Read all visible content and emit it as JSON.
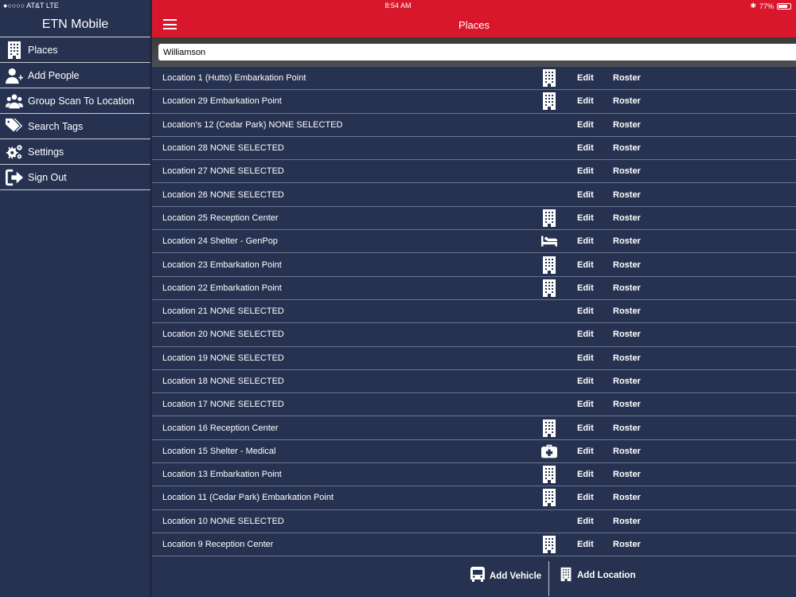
{
  "status": {
    "carrier": "●○○○○ AT&T  LTE",
    "time": "8:54 AM",
    "battery": "77%",
    "battery_level": 0.77
  },
  "sidebar": {
    "title": "ETN Mobile",
    "items": [
      {
        "label": "Places",
        "icon": "building-icon"
      },
      {
        "label": "Add People",
        "icon": "add-user-icon"
      },
      {
        "label": "Group Scan To Location",
        "icon": "group-icon"
      },
      {
        "label": "Search Tags",
        "icon": "tags-icon"
      },
      {
        "label": "Settings",
        "icon": "gears-icon"
      },
      {
        "label": "Sign Out",
        "icon": "sign-out-icon"
      }
    ]
  },
  "header": {
    "title": "Places"
  },
  "search": {
    "value": "Williamson"
  },
  "actions": {
    "edit": "Edit",
    "roster": "Roster"
  },
  "places": [
    {
      "name": "Location 1  (Hutto) Embarkation Point",
      "icon": "building"
    },
    {
      "name": "Location 29 Embarkation Point",
      "icon": "building"
    },
    {
      "name": "Location's 12  (Cedar Park) NONE SELECTED",
      "icon": ""
    },
    {
      "name": "Location 28 NONE SELECTED",
      "icon": ""
    },
    {
      "name": "Location 27 NONE SELECTED",
      "icon": ""
    },
    {
      "name": "Location 26 NONE SELECTED",
      "icon": ""
    },
    {
      "name": "Location 25 Reception Center",
      "icon": "building"
    },
    {
      "name": "Location 24 Shelter - GenPop",
      "icon": "bed"
    },
    {
      "name": "Location 23 Embarkation Point",
      "icon": "building"
    },
    {
      "name": "Location 22 Embarkation Point",
      "icon": "building"
    },
    {
      "name": "Location 21 NONE SELECTED",
      "icon": ""
    },
    {
      "name": "Location 20 NONE SELECTED",
      "icon": ""
    },
    {
      "name": "Location 19 NONE SELECTED",
      "icon": ""
    },
    {
      "name": "Location 18 NONE SELECTED",
      "icon": ""
    },
    {
      "name": "Location 17 NONE SELECTED",
      "icon": ""
    },
    {
      "name": "Location 16 Reception Center",
      "icon": "building"
    },
    {
      "name": "Location 15 Shelter - Medical",
      "icon": "medical"
    },
    {
      "name": "Location 13 Embarkation Point",
      "icon": "building"
    },
    {
      "name": "Location 11  (Cedar Park) Embarkation Point",
      "icon": "building"
    },
    {
      "name": "Location 10 NONE SELECTED",
      "icon": ""
    },
    {
      "name": "Location 9 Reception Center",
      "icon": "building"
    }
  ],
  "footer": {
    "add_vehicle": "Add Vehicle",
    "add_location": "Add Location"
  }
}
